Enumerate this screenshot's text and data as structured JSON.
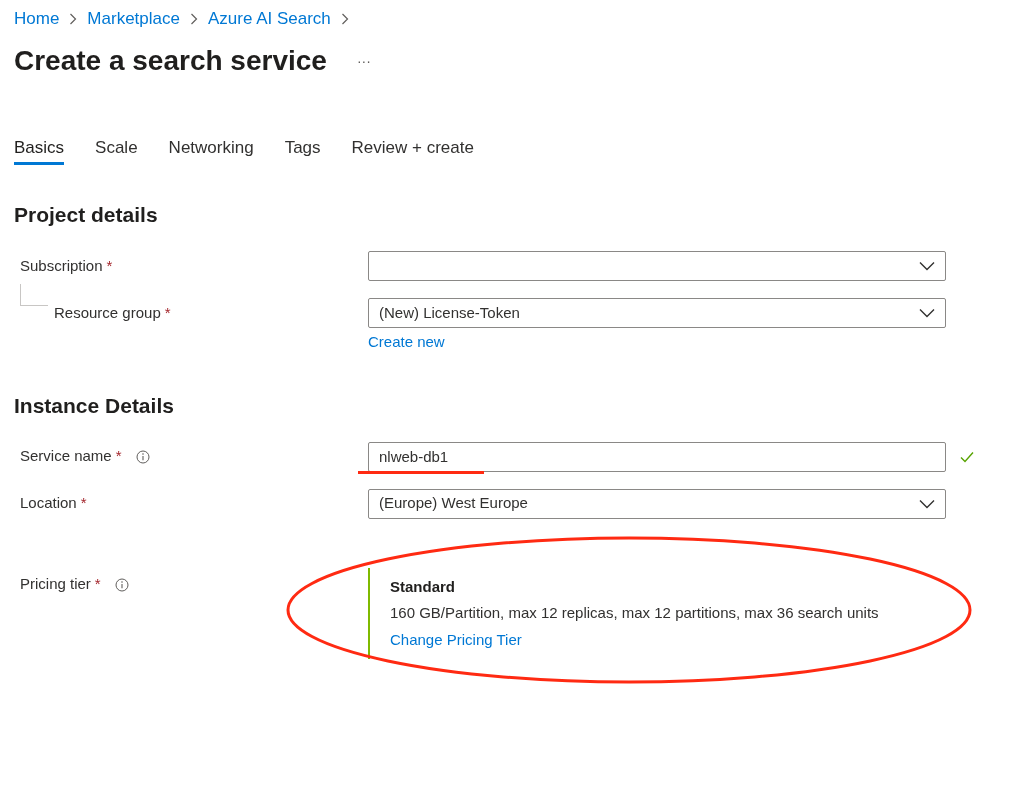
{
  "breadcrumb": [
    "Home",
    "Marketplace",
    "Azure AI Search"
  ],
  "title": "Create a search service",
  "more": "···",
  "tabs": [
    {
      "label": "Basics",
      "selected": true
    },
    {
      "label": "Scale",
      "selected": false
    },
    {
      "label": "Networking",
      "selected": false
    },
    {
      "label": "Tags",
      "selected": false
    },
    {
      "label": "Review + create",
      "selected": false
    }
  ],
  "sections": [
    {
      "heading": "Project details",
      "rows": [
        {
          "kind": "select",
          "label": "Subscription",
          "required_mark": "*",
          "children": [
            {
              "kind": "select",
              "label": "Resource group",
              "required_mark": "*",
              "value": "(New) License-Token",
              "link": "Create new"
            }
          ]
        }
      ]
    },
    {
      "heading": "Instance Details",
      "rows": [
        {
          "kind": "text",
          "label": "Service name",
          "required_mark": "*",
          "info": true,
          "value": "nlweb-db1",
          "valid": true,
          "underlined": true
        },
        {
          "kind": "select",
          "label": "Location",
          "required_mark": "*",
          "value": "(Europe) West Europe"
        },
        {
          "kind": "tier",
          "label": "Pricing tier",
          "required_mark": "*",
          "info": true,
          "circled": true,
          "tier": "Standard",
          "description": "160 GB/Partition, max 12 replicas, max 12 partitions, max 36 search units",
          "link": "Change Pricing Tier"
        }
      ]
    }
  ]
}
